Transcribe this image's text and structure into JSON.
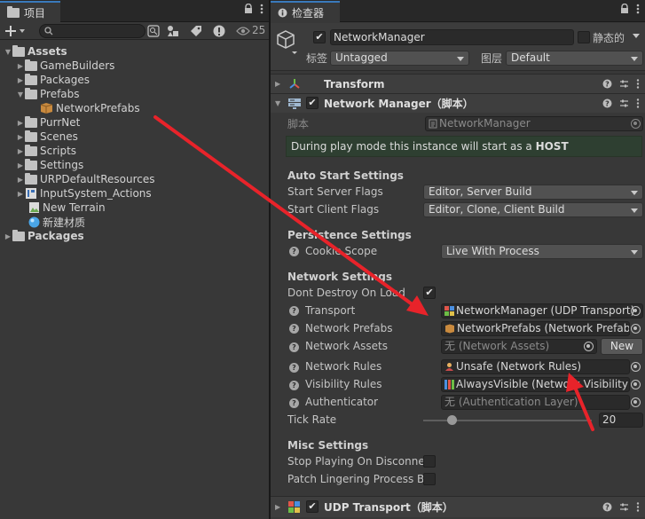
{
  "project_panel": {
    "tab_label": "项目",
    "hidden_count": "25",
    "tree": [
      {
        "label": "Assets",
        "bold": true
      },
      {
        "label": "GameBuilders"
      },
      {
        "label": "Packages"
      },
      {
        "label": "Prefabs"
      },
      {
        "label": "NetworkPrefabs"
      },
      {
        "label": "PurrNet"
      },
      {
        "label": "Scenes"
      },
      {
        "label": "Scripts"
      },
      {
        "label": "Settings"
      },
      {
        "label": "URPDefaultResources"
      },
      {
        "label": "InputSystem_Actions"
      },
      {
        "label": "New Terrain"
      },
      {
        "label": "新建材质"
      },
      {
        "label": "Packages",
        "bold": true
      }
    ]
  },
  "inspector": {
    "tab_label": "检查器",
    "object_name": "NetworkManager",
    "static_label": "静态的",
    "tag_label": "标签",
    "tag_value": "Untagged",
    "layer_label": "图层",
    "layer_value": "Default",
    "components": {
      "transform": "Transform",
      "network_manager": "Network Manager（脚本）",
      "udp_transport": "UDP Transport（脚本）"
    },
    "script_label": "脚本",
    "script_value": "NetworkManager",
    "info_prefix": "During play mode this instance will start as a ",
    "info_bold": "HOST",
    "sections": {
      "auto_start": "Auto Start Settings",
      "persistence": "Persistence Settings",
      "network": "Network Settings",
      "misc": "Misc Settings"
    },
    "fields": {
      "start_server_flags": {
        "label": "Start Server Flags",
        "value": "Editor, Server Build"
      },
      "start_client_flags": {
        "label": "Start Client Flags",
        "value": "Editor, Clone, Client Build"
      },
      "cookie_scope": {
        "label": "Cookie Scope",
        "value": "Live With Process"
      },
      "dont_destroy": {
        "label": "Dont Destroy On Load"
      },
      "transport": {
        "label": "Transport",
        "value": "NetworkManager (UDP Transport)"
      },
      "network_prefabs": {
        "label": "Network Prefabs",
        "value": "NetworkPrefabs (Network Prefabs)"
      },
      "network_assets": {
        "label": "Network Assets",
        "value": "无 (Network Assets)"
      },
      "network_rules": {
        "label": "Network Rules",
        "value": "Unsafe (Network Rules)"
      },
      "visibility_rules": {
        "label": "Visibility Rules",
        "value": "AlwaysVisible (Network Visibility Rules)"
      },
      "authenticator": {
        "label": "Authenticator",
        "value": "无 (Authentication Layer)"
      },
      "tick_rate": {
        "label": "Tick Rate",
        "value": "20"
      },
      "stop_playing": {
        "label": "Stop Playing On Disconnect"
      },
      "patch_lingering": {
        "label": "Patch Lingering Process Bug"
      }
    },
    "new_button": "New"
  },
  "colors": {
    "tab_accent": "#3a79bb",
    "annotation_arrow": "#e8232a",
    "info_bg": "#2e3f31"
  }
}
